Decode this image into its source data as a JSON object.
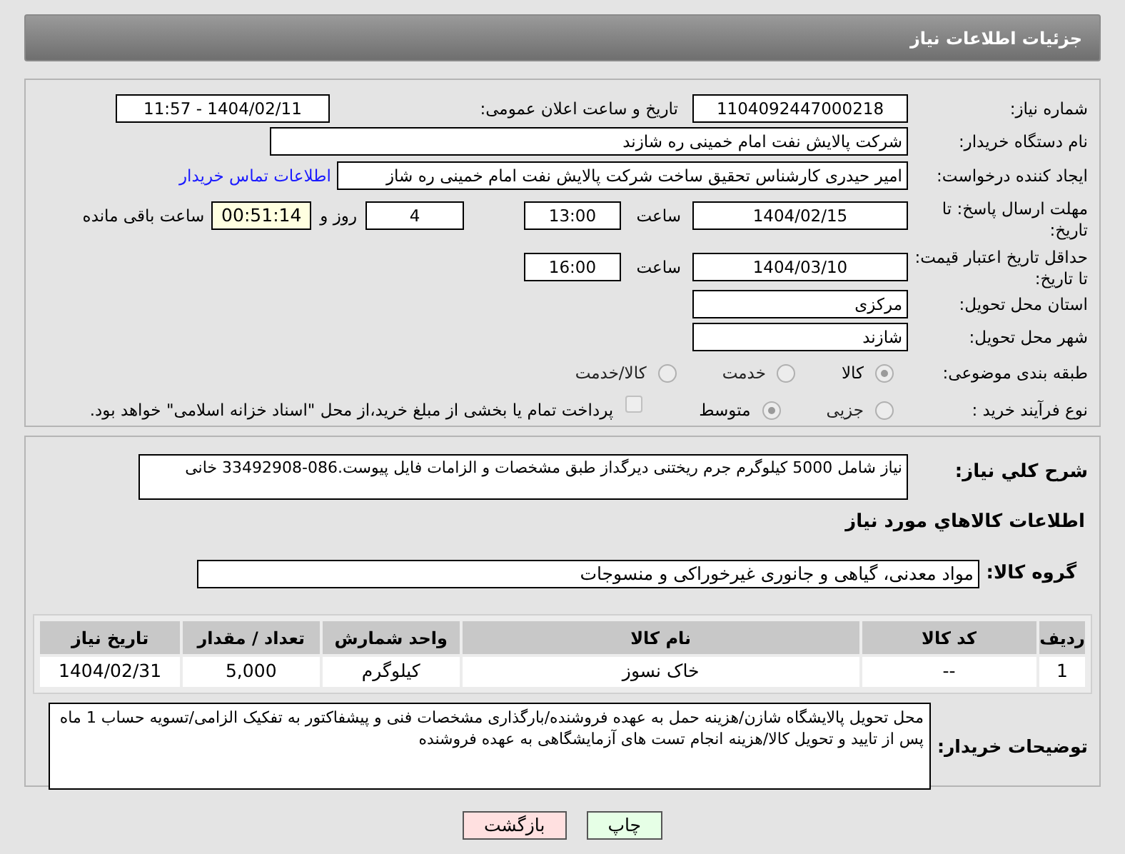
{
  "header": {
    "title": "جزئیات اطلاعات نیاز"
  },
  "need_number": {
    "label": "شماره نیاز:",
    "value": "1104092447000218"
  },
  "announce": {
    "label": "تاریخ و ساعت اعلان عمومی:",
    "value": "1404/02/11 - 11:57"
  },
  "buyer": {
    "label": "نام دستگاه خریدار:",
    "value": "شرکت پالایش نفت امام خمینی  ره  شازند"
  },
  "requester": {
    "label": "ایجاد کننده درخواست:",
    "value": "امیر  حیدری کارشناس تحقیق ساخت شرکت پالایش نفت امام خمینی  ره  شاز",
    "link": "اطلاعات تماس خریدار"
  },
  "deadline": {
    "label": "مهلت ارسال پاسخ: تا تاریخ:",
    "date": "1404/02/15",
    "time_label": "ساعت",
    "time": "13:00",
    "days": "4",
    "days_label": "روز و",
    "remaining": "00:51:14",
    "remaining_label": "ساعت باقی مانده"
  },
  "validity": {
    "label": "حداقل تاریخ اعتبار قیمت: تا تاریخ:",
    "date": "1404/03/10",
    "time_label": "ساعت",
    "time": "16:00"
  },
  "province": {
    "label": "استان محل تحویل:",
    "value": "مرکزی"
  },
  "city": {
    "label": "شهر محل تحویل:",
    "value": "شازند"
  },
  "category": {
    "label": "طبقه بندی موضوعی:",
    "options": [
      {
        "label": "کالا",
        "selected": true
      },
      {
        "label": "خدمت",
        "selected": false
      },
      {
        "label": "کالا/خدمت",
        "selected": false
      }
    ]
  },
  "process": {
    "label": "نوع فرآیند خرید :",
    "options": [
      {
        "label": "جزیی",
        "selected": false
      },
      {
        "label": "متوسط",
        "selected": true
      }
    ],
    "checkbox": {
      "checked": false,
      "label": "پرداخت تمام یا بخشی از مبلغ خرید،از محل \"اسناد خزانه اسلامی\" خواهد بود."
    }
  },
  "description": {
    "label": "شرح کلي نياز:",
    "value": "نیاز شامل 5000 کیلوگرم جرم ریختنی دیرگداز طبق مشخصات و الزامات فایل پیوست.086-33492908 خانی"
  },
  "goods_title": "اطلاعات کالاهاي مورد نياز",
  "goods_group": {
    "label": "گروه کالا:",
    "value": "مواد معدنی، گیاهی و جانوری غیرخوراکی و منسوجات"
  },
  "table": {
    "columns": [
      "ردیف",
      "کد کالا",
      "نام کالا",
      "واحد شمارش",
      "تعداد / مقدار",
      "تاریخ نیاز"
    ],
    "rows": [
      [
        "1",
        "--",
        "خاک نسوز",
        "کیلوگرم",
        "5,000",
        "1404/02/31"
      ]
    ]
  },
  "buyer_notes": {
    "label": "توضیحات خریدار:",
    "value": "محل تحویل پالایشگاه شازن/هزینه حمل به عهده فروشنده/بارگذاری مشخصات فنی و پیشفاکتور به تفکیک الزامی/تسویه حساب 1 ماه پس از تایید و تحویل کالا/هزینه انجام تست های آزمایشگاهی به عهده فروشنده"
  },
  "buttons": [
    {
      "label": "چاپ",
      "kind": "print"
    },
    {
      "label": "بازگشت",
      "kind": "back"
    }
  ]
}
